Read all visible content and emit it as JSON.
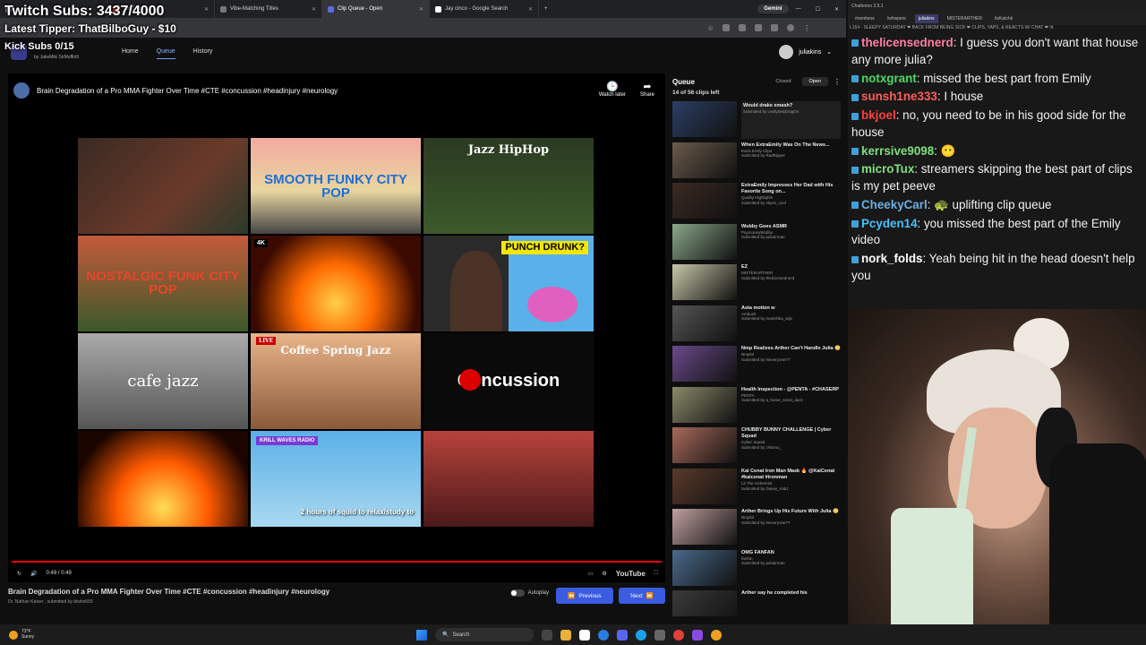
{
  "overlay": {
    "twitch_subs": "Twitch Subs: 3437/4000",
    "latest_tipper": "Latest Tipper: ThatBilboGuy - $10",
    "kick_subs": "Kick Subs 0/15"
  },
  "browser": {
    "tabs": [
      {
        "label": "YouTube",
        "active": false
      },
      {
        "label": "Vibe-Matching Titles",
        "active": false
      },
      {
        "label": "Clip Queue - Open",
        "active": true
      },
      {
        "label": "Jay cinco - Google Search",
        "active": false
      }
    ],
    "gemini_label": "Gemini"
  },
  "site": {
    "byline": "by JakeMiki SirMuffin9",
    "nav": {
      "home": "Home",
      "queue": "Queue",
      "history": "History"
    },
    "username": "juliakins"
  },
  "player": {
    "title": "Brain Degradation of a Pro MMA Fighter Over Time #CTE #concussion #headinjury #neurology",
    "watch_later": "Watch later",
    "share": "Share",
    "time": "0:49 / 0:49",
    "progress": 1.0,
    "youtube": "YouTube",
    "thumbnails": {
      "c2": "SMOOTH FUNKY CITY POP",
      "c3": "Jazz HipHop",
      "c4": "NOSTALGIC FUNK CITY POP",
      "c5_badge": "4K",
      "c6": "PUNCH DRUNK?",
      "c7": "cafe jazz",
      "c8_badge": "LIVE",
      "c8": "Coffee Spring Jazz",
      "c9": "Concussion",
      "c11_badge": "KRILL WAVES RADIO",
      "c11": "2 hours of squid to relax/study to"
    }
  },
  "below": {
    "title": "Brain Degradation of a Pro MMA Fighter Over Time #CTE #concussion #headinjury #neurology",
    "submitted": "Dr. Nathan Keiser , submitted by blwho555",
    "autoplay": "Autoplay",
    "previous": "Previous",
    "next": "Next"
  },
  "queue": {
    "title": "Queue",
    "closed": "Closed",
    "open": "Open",
    "count": "14 of 56 clips left",
    "items": [
      {
        "title": "Would drake smash?",
        "channel": "",
        "submitter": "Submitted by LeafySeaDragOn"
      },
      {
        "title": "When ExtraEmily Was On The News...",
        "channel": "Extra Emily Clips",
        "submitter": "Submitted by RadRipper"
      },
      {
        "title": "ExtraEmily Impresses Her Dad with His Favorite Song on...",
        "channel": "Quality Highlights",
        "submitter": "Submitted by skyze_cool"
      },
      {
        "title": "Wubby Goes ASMR",
        "channel": "PaymoneyWubby",
        "submitter": "Submitted by pdxairman"
      },
      {
        "title": "EZ",
        "channel": "MISTERARTHER",
        "submitter": "Submitted by thelicensednerd"
      },
      {
        "title": "Asta motion w",
        "channel": "Ambush",
        "submitter": "Submitted by manishka_wije"
      },
      {
        "title": "Nmp Realizes Arther Can't Handle Julia 😳",
        "channel": "Nmplol",
        "submitter": "Submitted by hieveryone77"
      },
      {
        "title": "Health Inspection - @PENTA - #CHASERP",
        "channel": "PENTA",
        "submitter": "Submitted by a_horse_sized_duck"
      },
      {
        "title": "CHUBBY BUNNY CHALLENGE | Cyber Squad",
        "channel": "Cyber Squad",
        "submitter": "Submitted by zNismo_"
      },
      {
        "title": "Kai Cenat Iron Man Mask 🔥 @KaiCenat #kaicenat #ironman",
        "channel": "Lit The Alchemist",
        "submitter": "Submitted by Davey_Kidd"
      },
      {
        "title": "Arther Brings Up His Future With Julia 😳",
        "channel": "Nmplol",
        "submitter": "Submitted by hieveryone77"
      },
      {
        "title": "OMG FANFAN",
        "channel": "fanfan",
        "submitter": "Submitted by pdxairman"
      },
      {
        "title": "Arther say he completed his",
        "channel": "",
        "submitter": ""
      }
    ]
  },
  "chat": {
    "app_title": "Chatterino 2.5.1",
    "tabs": {
      "mentions": "/mentions",
      "whispers": "/whispers",
      "juliakins": "juliakins",
      "misterarther": "MISTERARTHER",
      "itskatchii": "itsKatchii"
    },
    "ticker": "L164 - SLEEPY SATURDAY ❤ BACK FROM BEING SICK ❤ CLIPS, YAPS, & REACTS W/ CHAT ❤ !d",
    "messages": [
      {
        "user": "thelicensednerd",
        "color": "#ff7fa0",
        "text": "I guess you don't want that house any more julia?"
      },
      {
        "user": "notxgrant",
        "color": "#4cd964",
        "text": "missed the best part from Emily"
      },
      {
        "user": "sunsh1ne333",
        "color": "#ff5c5c",
        "text": "I house"
      },
      {
        "user": "bkjoel",
        "color": "#ff4040",
        "text": "no, you need to be in his good side for the house"
      },
      {
        "user": "kerrsive9098",
        "color": "#7fe07f",
        "text": "😶"
      },
      {
        "user": "microTux",
        "color": "#7fe07f",
        "text": "streamers skipping the best part of clips is my pet peeve"
      },
      {
        "user": "CheekyCarl",
        "color": "#6ab0e0",
        "text": "🐢 uplifting clip queue"
      },
      {
        "user": "Pcyden14",
        "color": "#49c0ff",
        "text": "you missed the best part of the Emily video"
      },
      {
        "user": "nork_folds",
        "color": "#ffffff",
        "text": "Yeah being hit in the head doesn't help you"
      }
    ]
  },
  "taskbar": {
    "temp": "73°F",
    "condition": "Sunny",
    "search": "Search"
  }
}
